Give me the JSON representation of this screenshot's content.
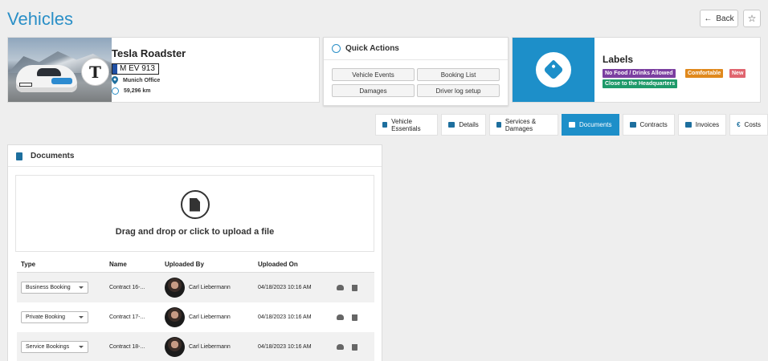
{
  "page": {
    "title": "Vehicles"
  },
  "header": {
    "back_label": "Back",
    "star_glyph": "☆",
    "back_glyph": "←"
  },
  "vehicle": {
    "name": "Tesla Roadster",
    "plate": "M EV 913",
    "location": "Munich Office",
    "mileage": "59,296 km",
    "brand_glyph": "T"
  },
  "quick_actions": {
    "title": "Quick Actions",
    "buttons": [
      "Vehicle Events",
      "Booking List",
      "Damages",
      "Driver log setup"
    ]
  },
  "labels": {
    "title": "Labels",
    "badges": [
      {
        "text": "No Food / Drinks Allowed",
        "color": "#7b3fa0"
      },
      {
        "text": "Comfortable",
        "color": "#e0891d"
      },
      {
        "text": "New",
        "color": "#e0656f"
      },
      {
        "text": "Close to the Headquarters",
        "color": "#1e9a6a"
      }
    ]
  },
  "tabs": [
    {
      "label": "Vehicle Essentials",
      "active": false
    },
    {
      "label": "Details",
      "active": false
    },
    {
      "label": "Services & Damages",
      "active": false
    },
    {
      "label": "Documents",
      "active": true
    },
    {
      "label": "Contracts",
      "active": false
    },
    {
      "label": "Invoices",
      "active": false
    },
    {
      "label": "Costs",
      "active": false
    }
  ],
  "documents": {
    "title": "Documents",
    "dropzone_text": "Drag and drop or click to upload a file",
    "columns": [
      "Type",
      "Name",
      "Uploaded By",
      "Uploaded On"
    ],
    "rows": [
      {
        "type": "Business Booking",
        "name": "Contract 16-...",
        "uploaded_by": "Carl Liebermann",
        "uploaded_on": "04/18/2023 10:16 AM"
      },
      {
        "type": "Private Booking",
        "name": "Contract 17-...",
        "uploaded_by": "Carl Liebermann",
        "uploaded_on": "04/18/2023 10:16 AM"
      },
      {
        "type": "Service Bookings",
        "name": "Contract 18-...",
        "uploaded_by": "Carl Liebermann",
        "uploaded_on": "04/18/2023 10:16 AM"
      }
    ]
  },
  "colors": {
    "accent": "#1d8fc9",
    "title": "#2a8fc7"
  }
}
